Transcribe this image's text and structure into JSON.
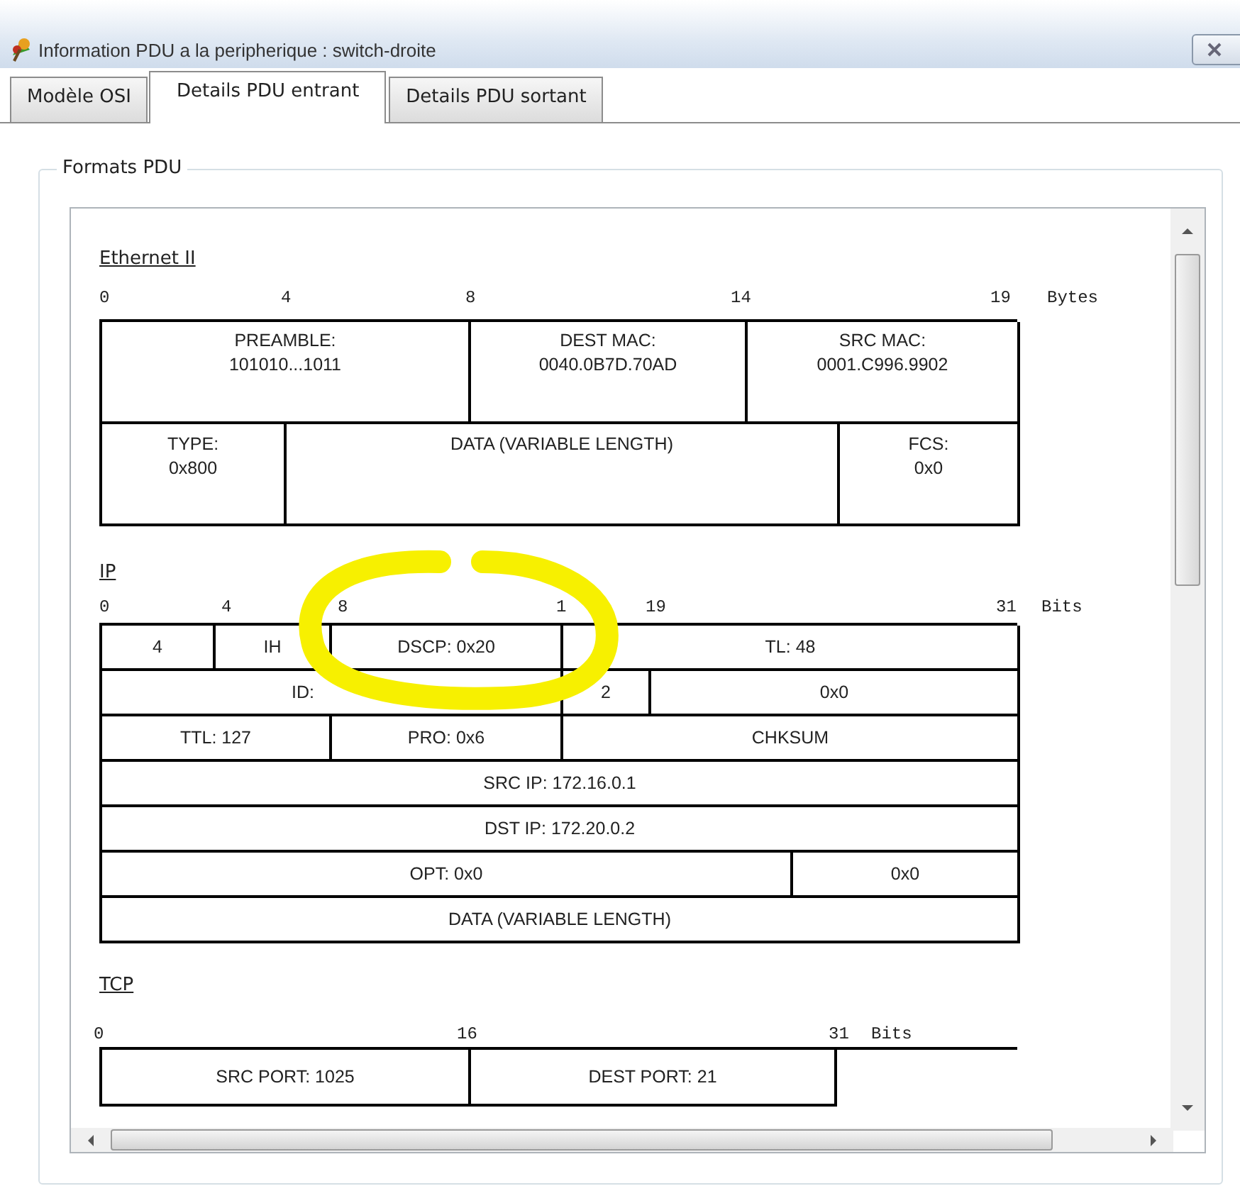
{
  "window": {
    "title": "Information PDU a la peripherique : switch-droite"
  },
  "tabs": [
    {
      "label": "Modèle OSI",
      "selected": false
    },
    {
      "label": "Details PDU entrant",
      "selected": true
    },
    {
      "label": "Details PDU sortant",
      "selected": false
    }
  ],
  "group": {
    "title": "Formats PDU"
  },
  "protocols": [
    {
      "name": "Ethernet II",
      "ticks": [
        "0",
        "4",
        "8",
        "14",
        "19"
      ],
      "unit": "Bytes",
      "rows": [
        [
          "PREAMBLE:\n101010...1011",
          "DEST MAC:\n0040.0B7D.70AD",
          "SRC MAC:\n0001.C996.9902"
        ],
        [
          "TYPE:\n0x800",
          "DATA (VARIABLE LENGTH)",
          "FCS:\n0x0"
        ]
      ]
    },
    {
      "name": "IP",
      "ticks": [
        "0",
        "4",
        "8",
        "1",
        "19",
        "31"
      ],
      "unit": "Bits",
      "rows": [
        [
          "4",
          "IH",
          "DSCP: 0x20",
          "TL: 48"
        ],
        [
          "ID:",
          "2",
          "0x0"
        ],
        [
          "TTL: 127",
          "PRO: 0x6",
          "CHKSUM"
        ],
        [
          "SRC IP: 172.16.0.1"
        ],
        [
          "DST IP: 172.20.0.2"
        ],
        [
          "OPT: 0x0",
          "0x0"
        ],
        [
          "DATA (VARIABLE LENGTH)"
        ]
      ],
      "annotation": {
        "kind": "circle"
      }
    },
    {
      "name": "TCP",
      "ticks": [
        "0",
        "16",
        "31"
      ],
      "unit": "Bits",
      "rows": [
        [
          "SRC PORT: 1025",
          "DEST PORT: 21"
        ]
      ]
    }
  ]
}
